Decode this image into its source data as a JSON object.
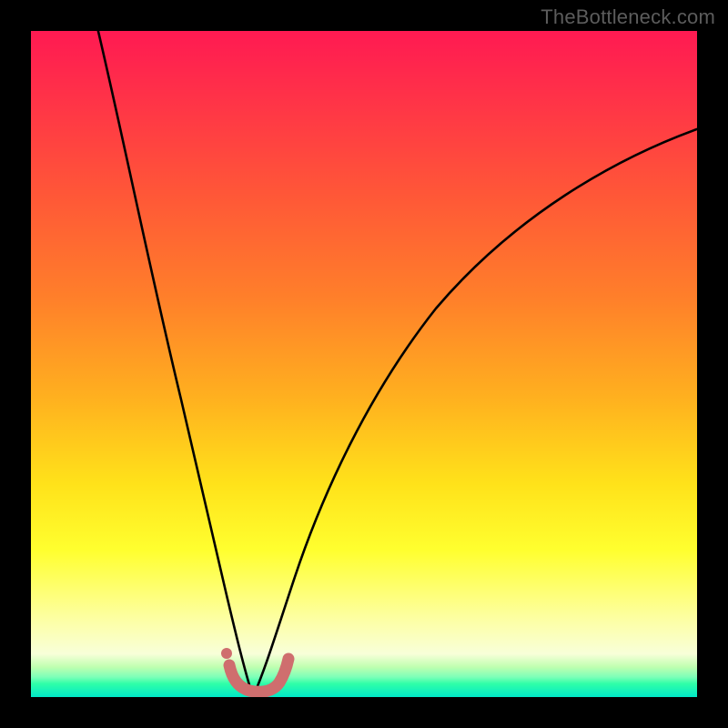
{
  "attribution": "TheBottleneck.com",
  "colors": {
    "frame": "#000000",
    "curve": "#000000",
    "marker": "#cc6a6a",
    "marker_fill": "#d07272"
  },
  "chart_data": {
    "type": "line",
    "title": "",
    "xlabel": "",
    "ylabel": "",
    "xlim": [
      0,
      100
    ],
    "ylim": [
      0,
      100
    ],
    "grid": false,
    "legend": false,
    "notes": "Axes unlabeled; values estimated from pixel positions with origin at bottom-left of the gradient plot area. Two black curves descend from the upper-left and upper-right edges to a common minimum near x≈33, y≈0. A pink/red thick U-shaped marker sits at the trough with a small detached dot just above its left end.",
    "series": [
      {
        "name": "left-curve",
        "x": [
          10,
          13,
          16,
          19,
          22,
          25,
          27,
          29,
          31,
          33
        ],
        "y": [
          100,
          82,
          67,
          53,
          41,
          30,
          21,
          13,
          6,
          0
        ]
      },
      {
        "name": "right-curve",
        "x": [
          33,
          35,
          38,
          42,
          47,
          53,
          60,
          70,
          82,
          100
        ],
        "y": [
          0,
          5,
          12,
          22,
          33,
          44,
          54,
          65,
          75,
          86
        ]
      },
      {
        "name": "trough-marker",
        "x": [
          30,
          30.5,
          31.5,
          33,
          35,
          36.5,
          37.5,
          38
        ],
        "y": [
          4.5,
          2.5,
          1.2,
          0.6,
          0.6,
          1.2,
          2.8,
          5.5
        ]
      }
    ],
    "points": [
      {
        "name": "trough-dot",
        "x": 29.5,
        "y": 6.5
      }
    ]
  }
}
